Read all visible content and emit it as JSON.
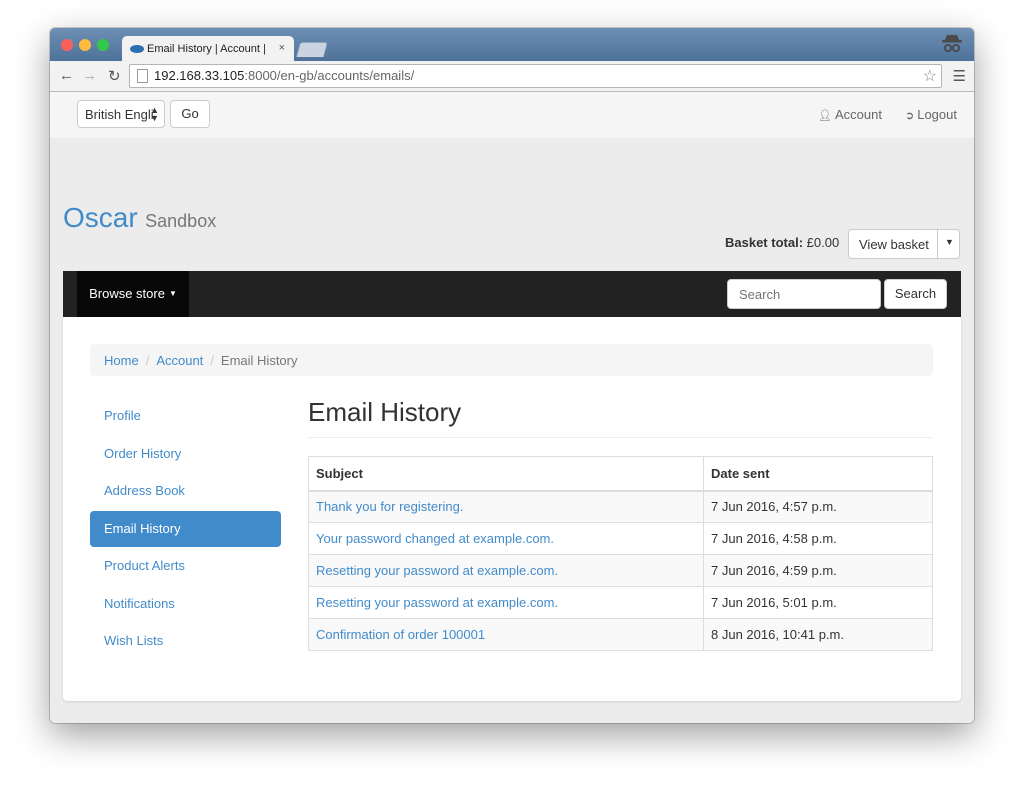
{
  "browser": {
    "tab_title": "Email History | Account | O",
    "tab_close": "×",
    "url_host": "192.168.33.105",
    "url_path": ":8000/en-gb/accounts/emails/",
    "icons": [
      "back-icon",
      "forward-icon",
      "reload-icon",
      "page-icon",
      "star-icon",
      "menu-icon",
      "incognito-icon"
    ]
  },
  "topbar": {
    "language": "British Engli",
    "go_label": "Go",
    "account_label": "Account",
    "logout_label": "Logout"
  },
  "brand": {
    "name": "Oscar",
    "suffix": "Sandbox"
  },
  "basket": {
    "total_label": "Basket total:",
    "total_value": "£0.00",
    "view_label": "View basket"
  },
  "navbar": {
    "browse_label": "Browse store",
    "search_placeholder": "Search",
    "search_button": "Search"
  },
  "breadcrumb": {
    "home": "Home",
    "account": "Account",
    "current": "Email History"
  },
  "sidenav": {
    "items": [
      {
        "label": "Profile",
        "active": false
      },
      {
        "label": "Order History",
        "active": false
      },
      {
        "label": "Address Book",
        "active": false
      },
      {
        "label": "Email History",
        "active": true
      },
      {
        "label": "Product Alerts",
        "active": false
      },
      {
        "label": "Notifications",
        "active": false
      },
      {
        "label": "Wish Lists",
        "active": false
      }
    ]
  },
  "main": {
    "title": "Email History",
    "table": {
      "headers": [
        "Subject",
        "Date sent"
      ],
      "rows": [
        {
          "subject": "Thank you for registering.",
          "date": "7 Jun 2016, 4:57 p.m."
        },
        {
          "subject": "Your password changed at example.com.",
          "date": "7 Jun 2016, 4:58 p.m."
        },
        {
          "subject": "Resetting your password at example.com.",
          "date": "7 Jun 2016, 4:59 p.m."
        },
        {
          "subject": "Resetting your password at example.com.",
          "date": "7 Jun 2016, 5:01 p.m."
        },
        {
          "subject": "Confirmation of order 100001",
          "date": "8 Jun 2016, 10:41 p.m."
        }
      ]
    }
  },
  "colors": {
    "link": "#428bca",
    "navbar": "#222222",
    "active_nav": "#428bca"
  }
}
